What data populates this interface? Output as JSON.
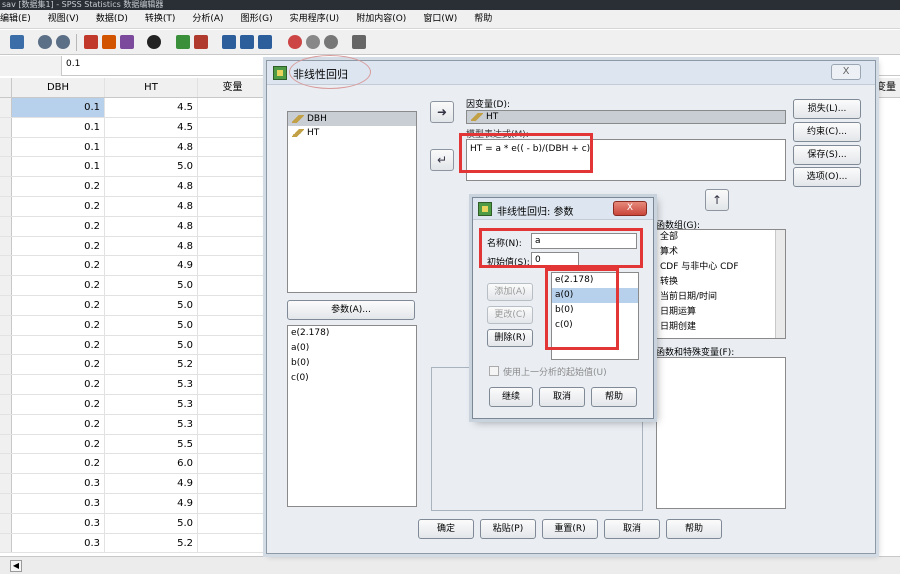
{
  "window_title": "sav [数据集1] - SPSS Statistics 数据编辑器",
  "menu": [
    "编辑(E)",
    "视图(V)",
    "数据(D)",
    "转换(T)",
    "分析(A)",
    "图形(G)",
    "实用程序(U)",
    "附加内容(O)",
    "窗口(W)",
    "帮助"
  ],
  "formula_bar": {
    "value": "0.1"
  },
  "grid": {
    "columns": [
      "DBH",
      "HT",
      "变量"
    ],
    "rows": [
      [
        "0.1",
        "4.5"
      ],
      [
        "0.1",
        "4.5"
      ],
      [
        "0.1",
        "4.8"
      ],
      [
        "0.1",
        "5.0"
      ],
      [
        "0.2",
        "4.8"
      ],
      [
        "0.2",
        "4.8"
      ],
      [
        "0.2",
        "4.8"
      ],
      [
        "0.2",
        "4.8"
      ],
      [
        "0.2",
        "4.9"
      ],
      [
        "0.2",
        "5.0"
      ],
      [
        "0.2",
        "5.0"
      ],
      [
        "0.2",
        "5.0"
      ],
      [
        "0.2",
        "5.0"
      ],
      [
        "0.2",
        "5.2"
      ],
      [
        "0.2",
        "5.3"
      ],
      [
        "0.2",
        "5.3"
      ],
      [
        "0.2",
        "5.3"
      ],
      [
        "0.2",
        "5.5"
      ],
      [
        "0.2",
        "6.0"
      ],
      [
        "0.3",
        "4.9"
      ],
      [
        "0.3",
        "4.9"
      ],
      [
        "0.3",
        "5.0"
      ],
      [
        "0.3",
        "5.2"
      ]
    ],
    "right_column_header": "变量"
  },
  "dialog": {
    "title": "非线性回归",
    "close_label": "X",
    "variables": [
      "DBH",
      "HT"
    ],
    "params_button": "参数(A)...",
    "params_list": [
      "e(2.178)",
      "a(0)",
      "b(0)",
      "c(0)"
    ],
    "dependent_label": "因变量(D):",
    "dependent_value": "HT",
    "model_expr_label": "模型表达式(M):",
    "model_expr": "HT = a * e(( - b)/(DBH + c))",
    "function_group_label": "函数组(G):",
    "function_groups": [
      "全部",
      "算术",
      "CDF 与非中心 CDF",
      "转换",
      "当前日期/时间",
      "日期运算",
      "日期创建"
    ],
    "functions_label": "函数和特殊变量(F):",
    "side_buttons": [
      "损失(L)...",
      "约束(C)...",
      "保存(S)...",
      "选项(O)..."
    ],
    "bottom_buttons": [
      "确定",
      "粘贴(P)",
      "重置(R)",
      "取消",
      "帮助"
    ]
  },
  "params_dialog": {
    "title": "非线性回归: 参数",
    "close_label": "X",
    "name_label": "名称(N):",
    "name_value": "a",
    "start_label": "初始值(S):",
    "start_value": "0",
    "add_button": "添加(A)",
    "change_button": "更改(C)",
    "delete_button": "删除(R)",
    "list": [
      "e(2.178)",
      "a(0)",
      "b(0)",
      "c(0)"
    ],
    "checkbox_label": "使用上一分析的起始值(U)",
    "continue_button": "继续",
    "cancel_button": "取消",
    "help_button": "帮助"
  }
}
